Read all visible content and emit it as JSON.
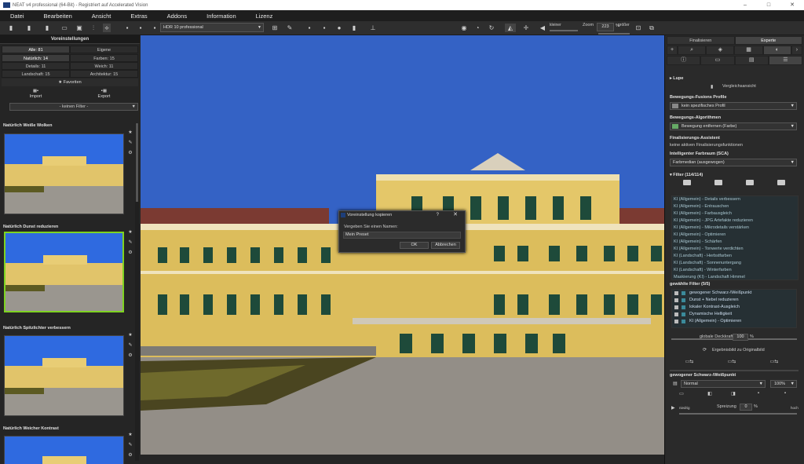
{
  "window": {
    "title": "NEAT v4 professional (64-Bit) - Registriert auf Accelerated Vision",
    "minimize": "–",
    "maximize": "□",
    "close": "✕"
  },
  "menu": [
    "Datei",
    "Bearbeiten",
    "Ansicht",
    "Extras",
    "Addons",
    "Information",
    "Lizenz"
  ],
  "toolbar": {
    "profile": "HDR 10 professional",
    "zoom_label": "Zoom",
    "zoom_value": "223",
    "zoom_unit": "%",
    "smaller": "kleiner",
    "larger": "größer"
  },
  "left_panel": {
    "header": "Voreinstellungen",
    "tabs": [
      "Alle: 81",
      "Eigene"
    ],
    "categories": [
      "Natürlich: 14",
      "Farben: 15",
      "Details: 11",
      "Weich: 11",
      "Landschaft: 15",
      "Architektur: 15"
    ],
    "favorites": "★ Favoriten",
    "import": "Import",
    "export": "Export",
    "filter": "- keinen Filter -",
    "presets": [
      "Natürlich Weiße Wolken",
      "Natürlich Dunst reduzieren",
      "Natürlich Spitzlichter verbessern",
      "Natürlich Weicher Kontrast"
    ]
  },
  "dialog": {
    "title": "Voreinstellung kopieren",
    "help": "?",
    "close": "✕",
    "prompt": "Vergeben Sie einen Namen:",
    "value": "Mein Preset",
    "ok": "OK",
    "cancel": "Abbrechen"
  },
  "right_panel": {
    "tabs": [
      "Finalisieren",
      "Experte"
    ],
    "lupe": "Lupe",
    "compare": "Vergleichsansicht",
    "fusion_title": "Bewegungs-Fusions Profile",
    "fusion_value": "kein spezifisches Profil",
    "algo_title": "Bewegungs-Algorithmen",
    "algo_value": "Bewegung entfernen (Farbe)",
    "final_title": "Finalisierungs-Assistent",
    "final_value": "keine aktiven Finalisierungsfunktionen",
    "color_title": "Intelligenter Farbraum (SCA)",
    "color_value": "Farbmedian (ausgewogen)",
    "filter_title": "Filter (114/114)",
    "filters": [
      "KI (Allgemein) - Details verbessern",
      "KI (Allgemein) - Entrauschen",
      "KI (Allgemein) - Farbausgleich",
      "KI (Allgemein) - JPG Artefakte reduzieren",
      "KI (Allgemein) - Mikrodetails verstärken",
      "KI (Allgemein) - Optimieren",
      "KI (Allgemein) - Schärfen",
      "KI (Allgemein) - Tonwerte verdichten",
      "KI (Landschaft) - Herbstfarben",
      "KI (Landschaft) - Sonnenuntergang",
      "KI (Landschaft) - Winterfarben",
      "Maskierung (KI) - Landschaft Himmel"
    ],
    "selected_title": "gewählte Filter (5/5)",
    "selected": [
      "gewogener Schwarz-/Weißpunkt",
      "Dunst + Nebel reduzieren",
      "lokaler Kontrast-Ausgleich",
      "Dynamische Helligkeit",
      "KI (Allgemein) - Optimieren"
    ],
    "opacity_label": "globale Deckkraft",
    "opacity_value": "100",
    "opacity_unit": "%",
    "result_label": "Ergebnisbild zu Originalbild",
    "bw_title": "gewogener Schwarz-/Weißpunkt",
    "bw_mode": "Normal",
    "bw_percent": "100%",
    "spread_label": "Spreizung",
    "spread_value": "0",
    "spread_unit": "%",
    "low": "niedrig",
    "high": "hoch"
  }
}
